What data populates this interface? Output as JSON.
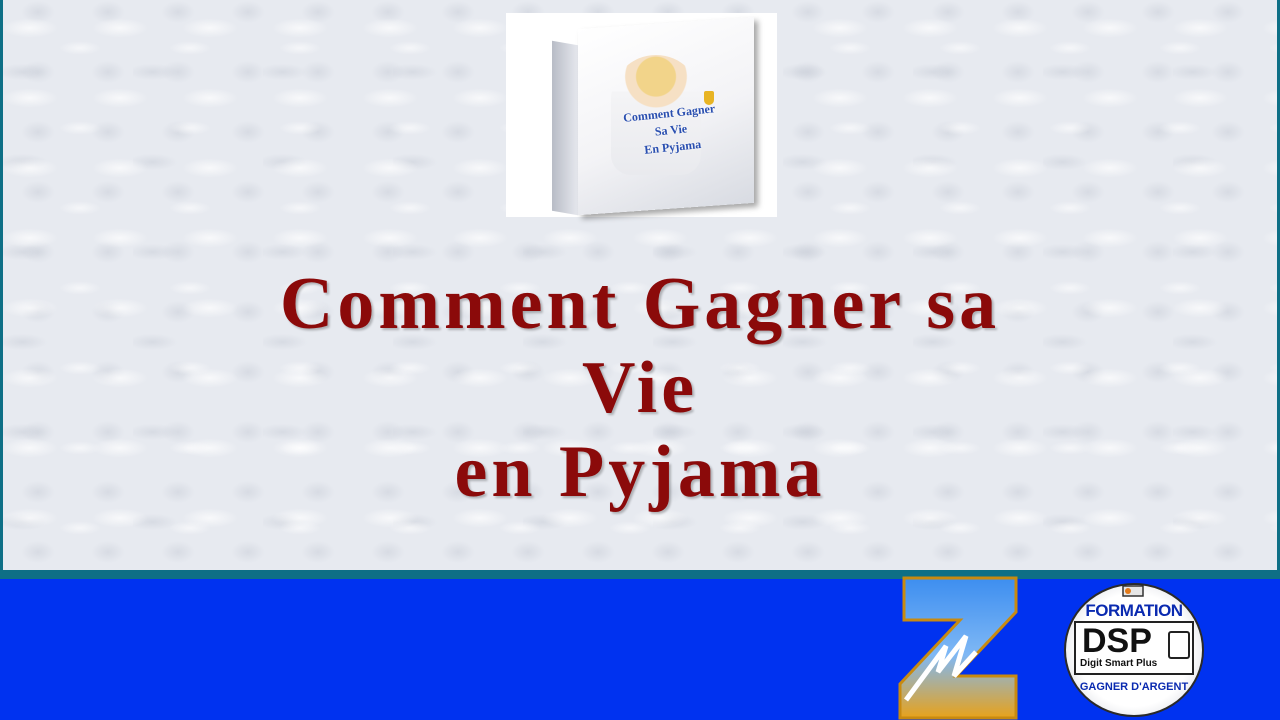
{
  "book": {
    "title_lines": [
      "Comment Gagner",
      "Sa Vie",
      "En Pyjama"
    ]
  },
  "headline": {
    "lines": [
      "Comment Gagner sa",
      "Vie",
      "en Pyjama"
    ]
  },
  "badge": {
    "top": "FORMATION",
    "letters": "DSP",
    "subtitle": "Digit Smart Plus",
    "bottom": "GAGNER D'ARGENT"
  },
  "colors": {
    "headline": "#8b0a0a",
    "divider": "#0e6f86",
    "bottom_bar": "#0032f0"
  }
}
